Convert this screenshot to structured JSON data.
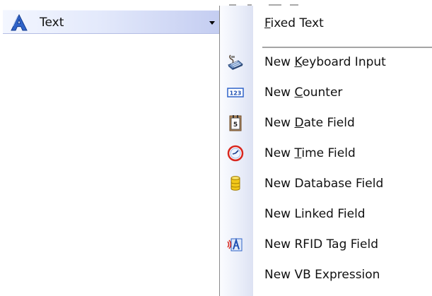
{
  "toolbar": {
    "text_button": {
      "label": "Text",
      "icon": "text-a-icon",
      "dropdown_icon": "chevron-down-icon"
    }
  },
  "menu": {
    "items": [
      {
        "pre": "",
        "mnemonic": "F",
        "post": "ixed Text",
        "icon": ""
      },
      {
        "pre": "New ",
        "mnemonic": "K",
        "post": "eyboard Input",
        "icon": "keyboard-input-icon"
      },
      {
        "pre": "New ",
        "mnemonic": "C",
        "post": "ounter",
        "icon": "counter-icon"
      },
      {
        "pre": "New ",
        "mnemonic": "D",
        "post": "ate Field",
        "icon": "date-field-icon"
      },
      {
        "pre": "New ",
        "mnemonic": "T",
        "post": "ime Field",
        "icon": "time-field-icon"
      },
      {
        "pre": "New Database Field",
        "mnemonic": "",
        "post": "",
        "icon": "database-field-icon"
      },
      {
        "pre": "New Linked Field",
        "mnemonic": "",
        "post": "",
        "icon": ""
      },
      {
        "pre": "New RFID Tag Field",
        "mnemonic": "",
        "post": "",
        "icon": "rfid-tag-icon"
      },
      {
        "pre": "New VB Expression",
        "mnemonic": "",
        "post": "",
        "icon": ""
      }
    ],
    "counter_icon_text": "123",
    "date_icon_text": "5"
  }
}
